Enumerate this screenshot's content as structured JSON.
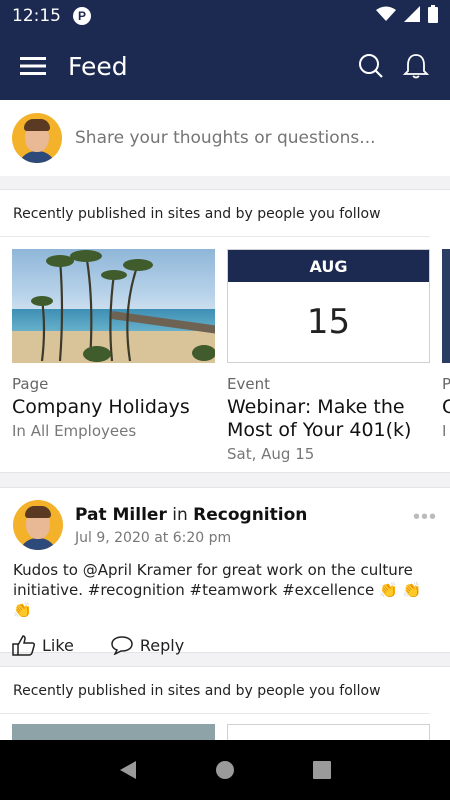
{
  "status_bar": {
    "time": "12:15",
    "app_icon_letter": "P"
  },
  "app_bar": {
    "title": "Feed"
  },
  "composer": {
    "placeholder": "Share your thoughts or questions..."
  },
  "recent_1": {
    "header": "Recently published in sites and by people you follow",
    "items": [
      {
        "type": "Page",
        "title": "Company Holidays",
        "subtitle": "In All Employees"
      },
      {
        "type": "Event",
        "title": "Webinar: Make the Most of Your 401(k)",
        "subtitle": "Sat, Aug 15",
        "month": "AUG",
        "day": "15"
      },
      {
        "type": "P",
        "title": "C",
        "subtitle": "I"
      }
    ]
  },
  "post": {
    "author": "Pat Miller",
    "in_text": "in",
    "site": "Recognition",
    "date": "Jul 9, 2020 at 6:20 pm",
    "body": "Kudos to @April Kramer for great work on the culture initiative. #recognition #teamwork  #excellence 👏 👏 👏",
    "like_label": "Like",
    "reply_label": "Reply"
  },
  "recent_2": {
    "header": "Recently published in sites and by people you follow"
  },
  "colors": {
    "brand": "#1c2951",
    "avatar_bg": "#f3b229"
  }
}
